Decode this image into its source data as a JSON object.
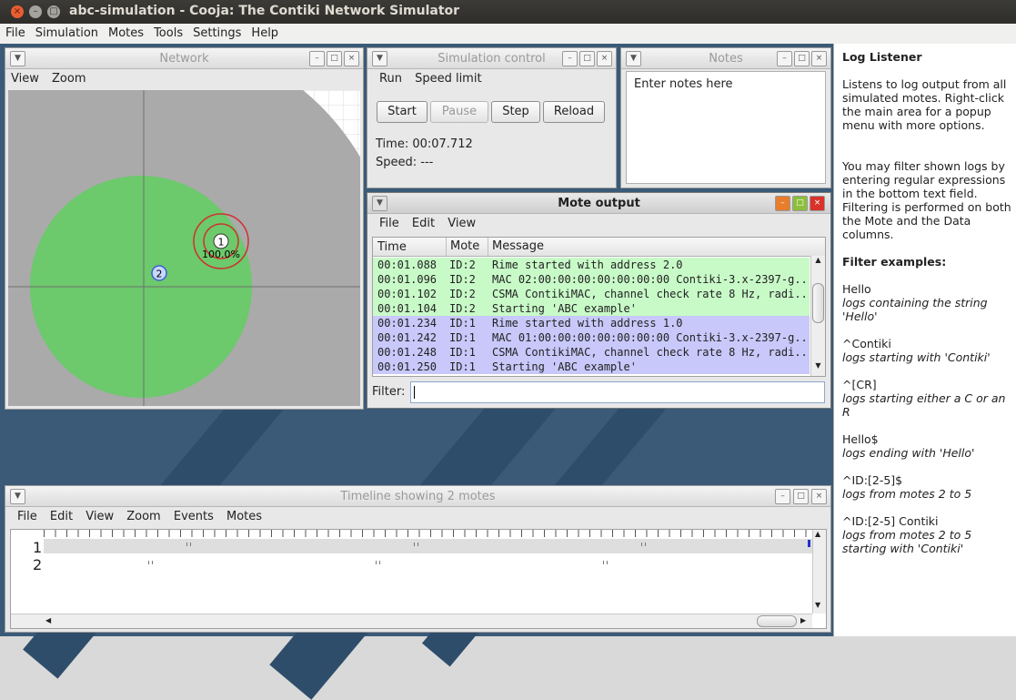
{
  "window": {
    "title": "abc-simulation - Cooja: The Contiki Network Simulator",
    "close_glyph": "×",
    "min_glyph": "–",
    "max_glyph": "□"
  },
  "menubar": [
    "File",
    "Simulation",
    "Motes",
    "Tools",
    "Settings",
    "Help"
  ],
  "network": {
    "title": "Network",
    "menu": [
      "View",
      "Zoom"
    ],
    "motes": [
      {
        "id": "1",
        "label": "100.0%"
      },
      {
        "id": "2"
      }
    ]
  },
  "simcontrol": {
    "title": "Simulation control",
    "menu": [
      "Run",
      "Speed limit"
    ],
    "buttons": {
      "start": "Start",
      "pause": "Pause",
      "step": "Step",
      "reload": "Reload"
    },
    "time": "Time: 00:07.712",
    "speed": "Speed: ---"
  },
  "notes": {
    "title": "Notes",
    "text": "Enter notes here"
  },
  "moteoutput": {
    "title": "Mote output",
    "menu": [
      "File",
      "Edit",
      "View"
    ],
    "columns": [
      "Time",
      "Mote",
      "Message"
    ],
    "rows": [
      {
        "time": "00:01.088",
        "mote": "ID:2",
        "msg": "Rime started with address 2.0"
      },
      {
        "time": "00:01.096",
        "mote": "ID:2",
        "msg": "MAC 02:00:00:00:00:00:00:00 Contiki-3.x-2397-g..."
      },
      {
        "time": "00:01.102",
        "mote": "ID:2",
        "msg": "CSMA ContikiMAC, channel check rate 8 Hz, radi..."
      },
      {
        "time": "00:01.104",
        "mote": "ID:2",
        "msg": "Starting 'ABC example'"
      },
      {
        "time": "00:01.234",
        "mote": "ID:1",
        "msg": "Rime started with address 1.0"
      },
      {
        "time": "00:01.242",
        "mote": "ID:1",
        "msg": "MAC 01:00:00:00:00:00:00:00 Contiki-3.x-2397-g..."
      },
      {
        "time": "00:01.248",
        "mote": "ID:1",
        "msg": "CSMA ContikiMAC, channel check rate 8 Hz, radi..."
      },
      {
        "time": "00:01.250",
        "mote": "ID:1",
        "msg": "Starting 'ABC example'"
      }
    ],
    "filter_label": "Filter:"
  },
  "timeline": {
    "title": "Timeline showing 2 motes",
    "menu": [
      "File",
      "Edit",
      "View",
      "Zoom",
      "Events",
      "Motes"
    ],
    "motes": [
      "1",
      "2"
    ]
  },
  "log": {
    "title": "Log Listener",
    "intro": "Listens to log output from all simulated motes. Right-click the main area for a popup menu with more options.",
    "intro2": "You may filter shown logs by entering regular expressions in the bottom text field. Filtering is performed on both the Mote and the Data columns.",
    "examples_title": "Filter examples:",
    "examples": [
      {
        "pattern": "Hello",
        "desc": "logs containing the string 'Hello'"
      },
      {
        "pattern": "^Contiki",
        "desc": "logs starting with 'Contiki'"
      },
      {
        "pattern": "^[CR]",
        "desc": "logs starting either a C or an R"
      },
      {
        "pattern": "Hello$",
        "desc": "logs ending with 'Hello'"
      },
      {
        "pattern": "^ID:[2-5]$",
        "desc": "logs from motes 2 to 5"
      },
      {
        "pattern": "^ID:[2-5] Contiki",
        "desc": "logs from motes 2 to 5 starting with 'Contiki'"
      }
    ]
  },
  "colors": {
    "mote2_rows": "#c8fac8",
    "mote1_rows": "#c8c8fa",
    "radio_range": "#6cc96c",
    "interference": "#aaaaaa"
  }
}
